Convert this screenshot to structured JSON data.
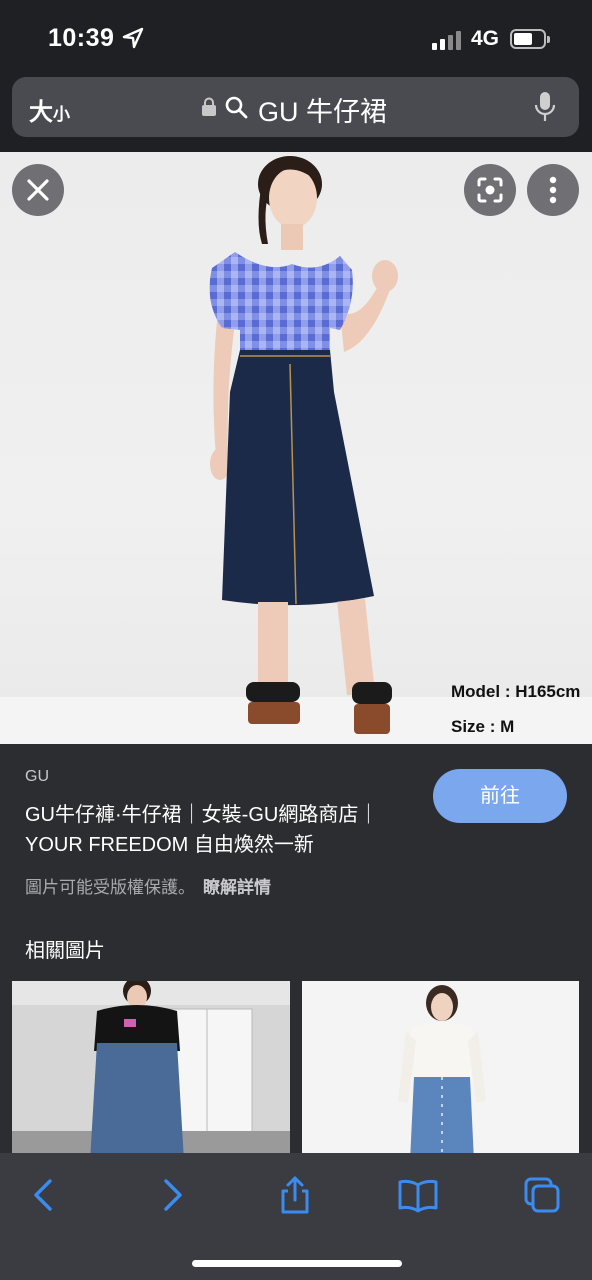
{
  "status_bar": {
    "time": "10:39",
    "network": "4G",
    "icons": [
      "location-arrow-icon",
      "signal-icon",
      "battery-icon"
    ]
  },
  "address_bar": {
    "text_size_label": "大",
    "text_size_small": "小",
    "url_text": "GU 牛仔裙",
    "icons": [
      "lock-icon",
      "search-icon",
      "microphone-icon"
    ]
  },
  "hero": {
    "caption_model": "Model : H165cm",
    "caption_size": "Size : M",
    "buttons": [
      "close-icon",
      "lens-icon",
      "more-icon"
    ]
  },
  "result": {
    "source": "GU",
    "title_line1": "GU牛仔褲·牛仔裙｜女裝-GU網路商店｜",
    "title_line2": "YOUR FREEDOM 自由煥然一新",
    "visit_label": "前往",
    "copyright_text": "圖片可能受版權保護。",
    "learn_more": "瞭解詳情"
  },
  "related": {
    "title": "相關圖片"
  },
  "toolbar": {
    "items": [
      "back-icon",
      "forward-icon",
      "share-icon",
      "bookmarks-icon",
      "tabs-icon"
    ],
    "accent": "#3b8cf0"
  }
}
